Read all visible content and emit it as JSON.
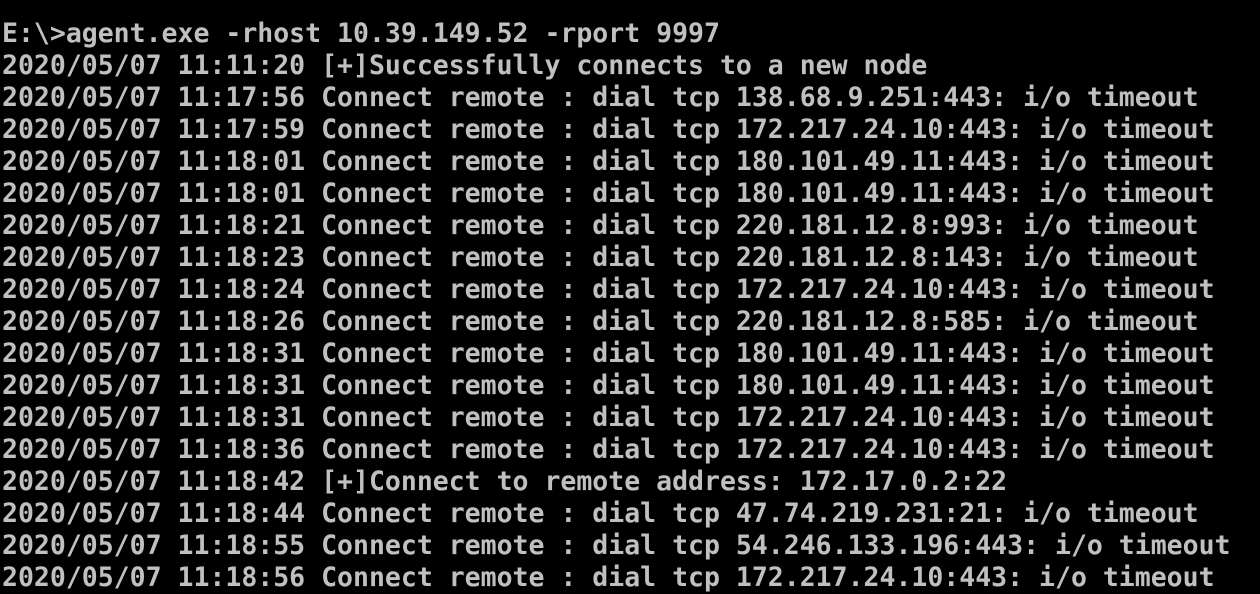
{
  "console": {
    "text_color": "#c0c0c0",
    "background_color": "#000000",
    "lines": [
      "E:\\>agent.exe -rhost 10.39.149.52 -rport 9997",
      "2020/05/07 11:11:20 [+]Successfully connects to a new node",
      "2020/05/07 11:17:56 Connect remote : dial tcp 138.68.9.251:443: i/o timeout",
      "2020/05/07 11:17:59 Connect remote : dial tcp 172.217.24.10:443: i/o timeout",
      "2020/05/07 11:18:01 Connect remote : dial tcp 180.101.49.11:443: i/o timeout",
      "2020/05/07 11:18:01 Connect remote : dial tcp 180.101.49.11:443: i/o timeout",
      "2020/05/07 11:18:21 Connect remote : dial tcp 220.181.12.8:993: i/o timeout",
      "2020/05/07 11:18:23 Connect remote : dial tcp 220.181.12.8:143: i/o timeout",
      "2020/05/07 11:18:24 Connect remote : dial tcp 172.217.24.10:443: i/o timeout",
      "2020/05/07 11:18:26 Connect remote : dial tcp 220.181.12.8:585: i/o timeout",
      "2020/05/07 11:18:31 Connect remote : dial tcp 180.101.49.11:443: i/o timeout",
      "2020/05/07 11:18:31 Connect remote : dial tcp 180.101.49.11:443: i/o timeout",
      "2020/05/07 11:18:31 Connect remote : dial tcp 172.217.24.10:443: i/o timeout",
      "2020/05/07 11:18:36 Connect remote : dial tcp 172.217.24.10:443: i/o timeout",
      "2020/05/07 11:18:42 [+]Connect to remote address: 172.17.0.2:22",
      "2020/05/07 11:18:44 Connect remote : dial tcp 47.74.219.231:21: i/o timeout",
      "2020/05/07 11:18:55 Connect remote : dial tcp 54.246.133.196:443: i/o timeout",
      "2020/05/07 11:18:56 Connect remote : dial tcp 172.217.24.10:443: i/o timeout"
    ]
  }
}
